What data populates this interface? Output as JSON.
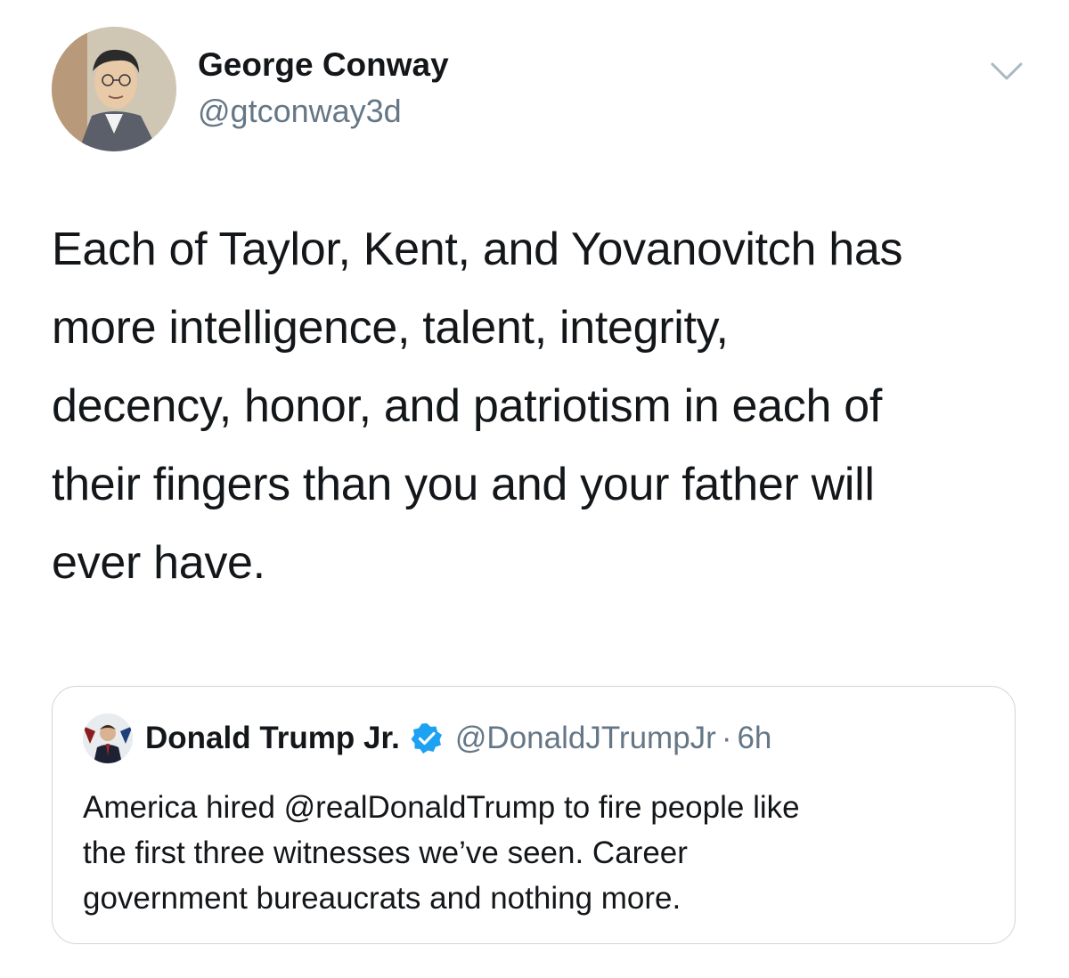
{
  "tweet": {
    "author": {
      "display_name": "George Conway",
      "handle": "@gtconway3d",
      "avatar_icon": "user-avatar"
    },
    "menu_icon": "chevron-down-icon",
    "text": "Each of Taylor, Kent, and Yovanovitch has\nmore intelligence, talent, integrity,\ndecency, honor, and patriotism in each of\ntheir fingers than you and your father will\never have.",
    "quoted_tweet": {
      "display_name": "Donald Trump Jr.",
      "verified_icon": "verified-badge-icon",
      "handle": "@DonaldJTrumpJr",
      "separator": "·",
      "time": "6h",
      "text": "America hired @realDonaldTrump to fire people like\nthe first three witnesses we’ve seen. Career\ngovernment bureaucrats and nothing more."
    }
  },
  "colors": {
    "text_primary": "#14171a",
    "text_secondary": "#657786",
    "border": "#ccd6dd",
    "verified_blue": "#1da1f2",
    "background": "#ffffff"
  }
}
